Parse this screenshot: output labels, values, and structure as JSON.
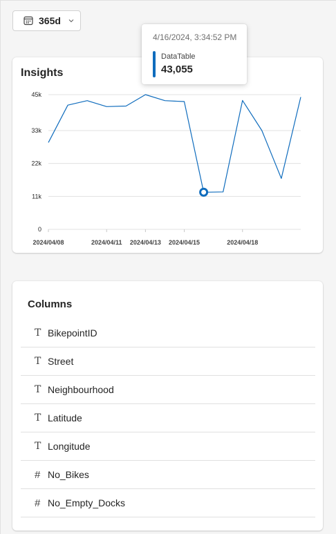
{
  "toolbar": {
    "range_label": "365d",
    "calendar_icon": "calendar-icon",
    "chevron_icon": "chevron-down-icon"
  },
  "insights": {
    "title": "Insights",
    "tooltip": {
      "timestamp": "4/16/2024, 3:34:52 PM",
      "series": "DataTable",
      "value": "43,055"
    }
  },
  "chart_data": {
    "type": "line",
    "title": "",
    "xlabel": "",
    "ylabel": "",
    "x": [
      "2024/04/08",
      "2024/04/09",
      "2024/04/10",
      "2024/04/11",
      "2024/04/12",
      "2024/04/13",
      "2024/04/14",
      "2024/04/15",
      "2024/04/16",
      "2024/04/17",
      "2024/04/18",
      "2024/04/19",
      "2024/04/20",
      "2024/04/21"
    ],
    "x_tick_labels": [
      "2024/04/08",
      "2024/04/11",
      "2024/04/13",
      "2024/04/15",
      "2024/04/18"
    ],
    "series": [
      {
        "values": [
          29000,
          41500,
          43000,
          41000,
          41200,
          45000,
          43000,
          42700,
          12400,
          12500,
          43055,
          33000,
          17000,
          44200
        ]
      }
    ],
    "y_ticks": [
      0,
      11000,
      22000,
      33000,
      45000
    ],
    "y_tick_labels": [
      "0",
      "11k",
      "22k",
      "33k",
      "45k"
    ],
    "ylim": [
      0,
      45000
    ],
    "grid": true,
    "legend": "none",
    "highlight_x": "2024/04/16",
    "color": "#0f6cbd"
  },
  "columns": {
    "title": "Columns",
    "items": [
      {
        "type": "text",
        "icon": "T",
        "name": "BikepointID"
      },
      {
        "type": "text",
        "icon": "T",
        "name": "Street"
      },
      {
        "type": "text",
        "icon": "T",
        "name": "Neighbourhood"
      },
      {
        "type": "text",
        "icon": "T",
        "name": "Latitude"
      },
      {
        "type": "text",
        "icon": "T",
        "name": "Longitude"
      },
      {
        "type": "number",
        "icon": "#",
        "name": "No_Bikes"
      },
      {
        "type": "number",
        "icon": "#",
        "name": "No_Empty_Docks"
      }
    ]
  }
}
